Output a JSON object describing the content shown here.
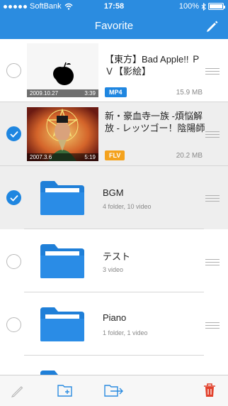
{
  "status": {
    "carrier": "SoftBank",
    "time": "17:58",
    "battery": "100%"
  },
  "navbar": {
    "title": "Favorite"
  },
  "rows": [
    {
      "kind": "video",
      "title": "【東方】Bad Apple!! ＰＶ【影絵】",
      "format": "MP4",
      "format_color": "#1f86e0",
      "size": "15.9 MB",
      "date": "2009.10.27",
      "duration": "3:39",
      "checked": false
    },
    {
      "kind": "video",
      "title": "新・豪血寺一族 -煩悩解放 - レッツゴー！陰陽師",
      "format": "FLV",
      "format_color": "#f4a21d",
      "size": "20.2 MB",
      "date": "2007.3.6",
      "duration": "5:19",
      "checked": true
    },
    {
      "kind": "folder",
      "name": "BGM",
      "info": "4 folder, 10 video",
      "checked": true
    },
    {
      "kind": "folder",
      "name": "テスト",
      "info": "3 video",
      "checked": false
    },
    {
      "kind": "folder",
      "name": "Piano",
      "info": "1 folder, 1 video",
      "checked": false
    }
  ],
  "colors": {
    "accent": "#2b8ce0",
    "delete": "#e2412c"
  },
  "toolbar": {
    "icons": [
      "pencil-icon",
      "new-folder-icon",
      "move-icon",
      "trash-icon"
    ]
  }
}
